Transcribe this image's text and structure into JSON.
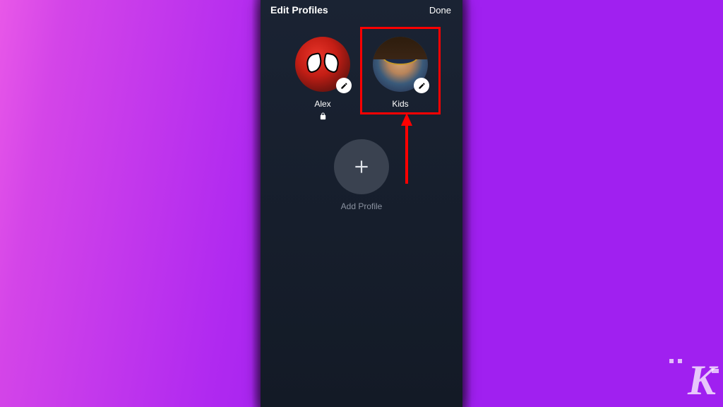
{
  "header": {
    "title": "Edit Profiles",
    "done_label": "Done"
  },
  "profiles": [
    {
      "name": "Alex",
      "avatar": "spiderman",
      "locked": true,
      "highlighted": false
    },
    {
      "name": "Kids",
      "avatar": "msmarvel",
      "locked": false,
      "highlighted": true
    }
  ],
  "add_profile": {
    "label": "Add Profile"
  },
  "watermark": "K"
}
